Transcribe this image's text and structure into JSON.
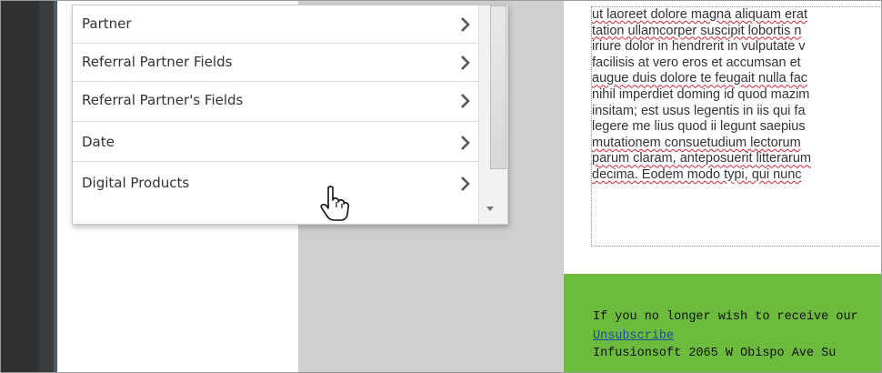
{
  "menu": {
    "items": [
      {
        "label": "Partner"
      },
      {
        "label": "Referral Partner Fields"
      },
      {
        "label": "Referral Partner's Fields"
      },
      {
        "label": "Date"
      },
      {
        "label": "Digital Products"
      }
    ]
  },
  "email": {
    "body_lines": [
      "ut laoreet dolore magna aliquam erat",
      "tation ullamcorper suscipit lobortis n",
      "iriure dolor in hendrerit in vulputate v",
      "facilisis at vero eros et accumsan et",
      "augue duis dolore te feugait nulla fac",
      "nihil imperdiet doming id quod mazim",
      "insitam; est usus legentis in iis qui fa",
      "legere me lius quod ii legunt saepius",
      "mutationem consuetudium lectorum",
      "parum claram, anteposuerit litterarum",
      "decima. Eodem modo typi, qui nunc"
    ],
    "footer": {
      "line1": "If you no longer wish to receive our",
      "unsubscribe": "Unsubscribe",
      "address": "Infusionsoft 2065 W Obispo Ave Su"
    }
  },
  "colors": {
    "footer_green": "#6cbb3c",
    "link_blue": "#1a4fa0",
    "sidebar_dark": "#2f3133",
    "gray_area": "#cfcfcf"
  }
}
